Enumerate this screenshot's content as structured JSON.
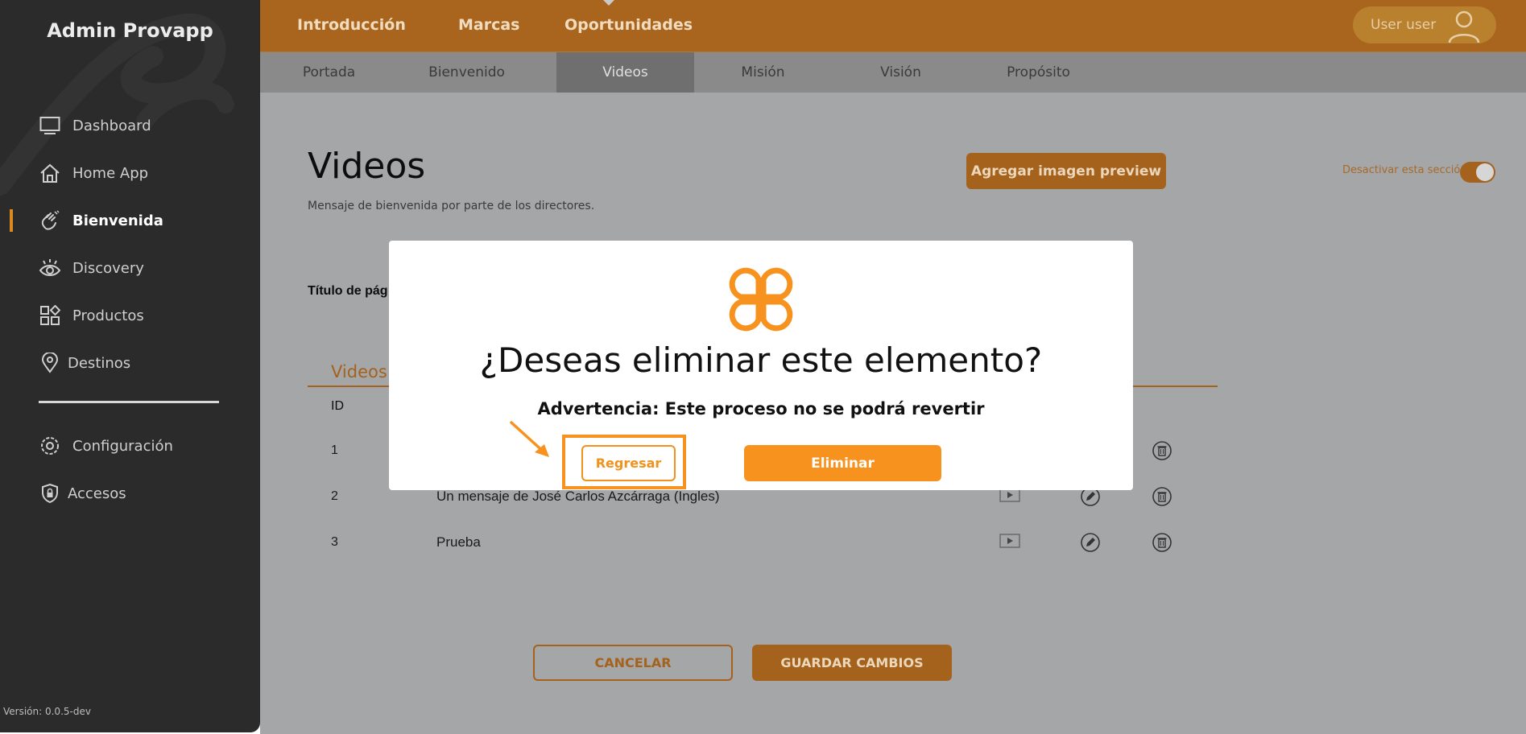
{
  "app_title": "Admin Provapp",
  "version": "Versión: 0.0.5-dev",
  "sidebar": {
    "items": [
      {
        "label": "Dashboard",
        "icon": "monitor-icon"
      },
      {
        "label": "Home App",
        "icon": "home-icon"
      },
      {
        "label": "Bienvenida",
        "icon": "waving-hand-icon",
        "active": true
      },
      {
        "label": "Discovery",
        "icon": "eye-icon"
      },
      {
        "label": "Productos",
        "icon": "grid-shapes-icon"
      },
      {
        "label": "Destinos",
        "icon": "location-pin-icon"
      },
      {
        "label": "Configuración",
        "icon": "gear-icon"
      },
      {
        "label": "Accesos",
        "icon": "shield-lock-icon"
      }
    ]
  },
  "topnav": {
    "items": [
      "Introducción",
      "Marcas",
      "Oportunidades"
    ],
    "user_label": "User user"
  },
  "subnav": {
    "tabs": [
      "Portada",
      "Bienvenido",
      "Videos",
      "Misión",
      "Visión",
      "Propósito"
    ],
    "active": "Videos"
  },
  "main": {
    "title": "Videos",
    "description": "Mensaje de bienvenida por parte de los directores.",
    "preview_button": "Agregar imagen preview",
    "toggle_label": "Desactivar esta sección",
    "toggle_on": true,
    "field_label": "Título de pág",
    "videos_heading": "Videos",
    "table": {
      "id_header": "ID",
      "rows": [
        {
          "id": "1",
          "title": ""
        },
        {
          "id": "2",
          "title": "Un mensaje de José Carlos Azcárraga (Ingles)"
        },
        {
          "id": "3",
          "title": "Prueba"
        }
      ]
    },
    "cancel_button": "CANCELAR",
    "save_button": "GUARDAR CAMBIOS"
  },
  "modal": {
    "title": "¿Deseas eliminar este elemento?",
    "warning": "Advertencia: Este proceso no se podrá revertir",
    "back_button": "Regresar",
    "delete_button": "Eliminar",
    "logo_icon": "clover-logo-icon"
  },
  "colors": {
    "accent": "#f7921e",
    "accent_dimmed": "#a5621c",
    "sidebar_bg": "#2b2b2b",
    "overlay_bg": "#a5a6a7"
  }
}
